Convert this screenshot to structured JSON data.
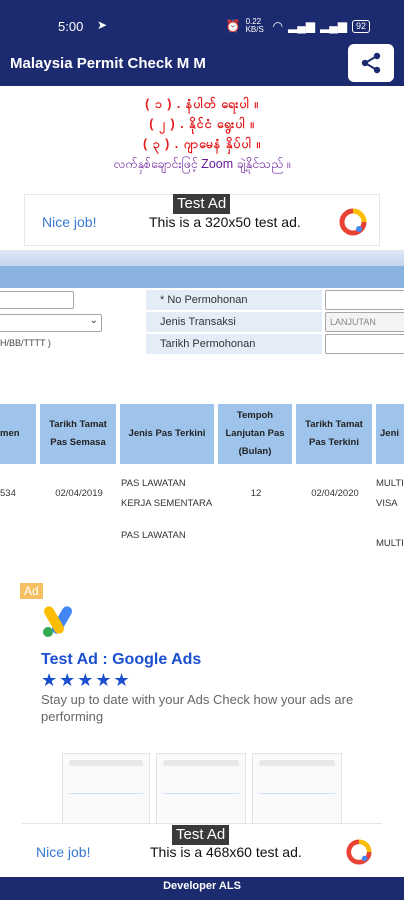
{
  "status_bar": {
    "time": "5:00",
    "network_speed": "0.22 KB/S",
    "battery": "92"
  },
  "app_bar": {
    "title": "Malaysia Permit Check M M"
  },
  "instructions": {
    "line1": "( ၁ ) . နံပါတ် ရေးပါ ။",
    "line2": "( ၂ ) . နိုင်ငံ ရွေးပါ ။",
    "line3": "( ၃ ) . ဂျာမေနံ နှိပ်ပါ ။",
    "line4": "လက်နှစ်ချောင်းဖြင့် Zoom ချဲ့နိုင်သည် ။"
  },
  "ad_small": {
    "tag": "Test Ad",
    "nice": "Nice job!",
    "text": "This is a 320x50 test ad."
  },
  "form": {
    "no_label": "* No Permohonan",
    "jenis_label": "Jenis Transaksi",
    "jenis_value": "LANJUTAN",
    "tarikh_label": "Tarikh Permohonan",
    "date_hint": "H/BB/TTTT )"
  },
  "table": {
    "headers": [
      "men",
      "Tarikh Tamat Pas Semasa",
      "Jenis Pas Terkini",
      "Tempoh Lanjutan Pas (Bulan)",
      "Tarikh Tamat Pas Terkini",
      "Jeni"
    ],
    "rows": [
      [
        "534",
        "02/04/2019",
        "PAS LAWATAN KERJA SEMENTARA",
        "12",
        "02/04/2020",
        "MULTI VISA"
      ],
      [
        "",
        "",
        "PAS LAWATAN",
        "",
        "",
        "MULTI"
      ]
    ]
  },
  "ad_big": {
    "badge": "Ad",
    "headline": "Test Ad : Google Ads",
    "stars": "★★★★★",
    "description": "Stay up to date with your Ads Check how your ads are performing"
  },
  "ad_large": {
    "tag": "Test Ad",
    "nice": "Nice job!",
    "text": "This is a 468x60 test ad."
  },
  "footer": {
    "text": "Developer ALS"
  },
  "colors": {
    "primary": "#1c2a6f",
    "accent_blue": "#1a4fcf",
    "instruction_red": "#e31b1b"
  }
}
